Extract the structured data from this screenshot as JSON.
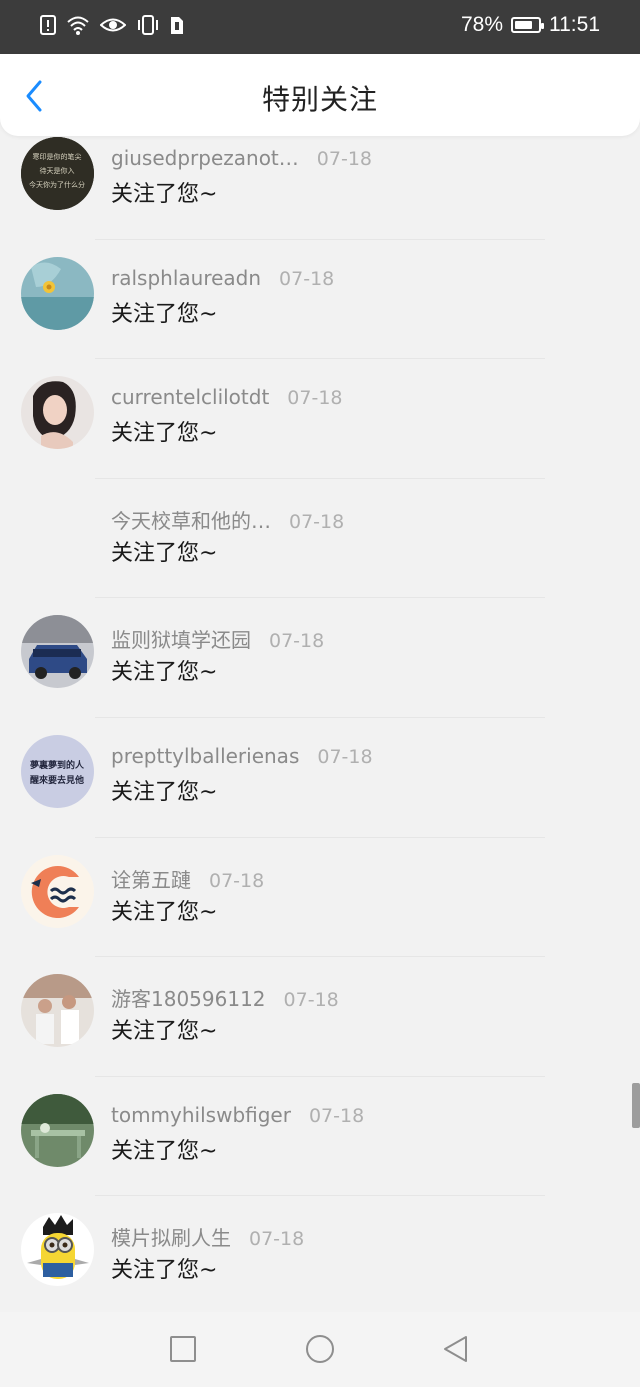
{
  "status_bar": {
    "battery": "78%",
    "time": "11:51",
    "battery_level": 0.78
  },
  "header": {
    "title": "特别关注"
  },
  "rows": [
    {
      "name": "giusedprpezanot…",
      "date": "07-18",
      "message": "关注了您~",
      "avatar_text": [
        "寒印是你的笔尖",
        "待天是你入",
        "今天你为了什么分"
      ]
    },
    {
      "name": "ralsphlaureadn",
      "date": "07-18",
      "message": "关注了您~"
    },
    {
      "name": "currentelclilotdt",
      "date": "07-18",
      "message": "关注了您~"
    },
    {
      "name": "今天校草和他的…",
      "date": "07-18",
      "message": "关注了您~"
    },
    {
      "name": "监则狱填学还园",
      "date": "07-18",
      "message": "关注了您~"
    },
    {
      "name": "prepttylballerienas",
      "date": "07-18",
      "message": "关注了您~",
      "avatar_text": [
        "夢裏夢到的人",
        "醒來要去見他"
      ]
    },
    {
      "name": "诠第五蹥",
      "date": "07-18",
      "message": "关注了您~"
    },
    {
      "name": "游客180596112",
      "date": "07-18",
      "message": "关注了您~"
    },
    {
      "name": "tommyhilswbfiger",
      "date": "07-18",
      "message": "关注了您~"
    },
    {
      "name": "模片拟刷人生",
      "date": "07-18",
      "message": "关注了您~"
    }
  ],
  "icons": {
    "status_left": [
      "alert-icon",
      "wifi-icon",
      "eye-icon",
      "vibrate-icon",
      "sim-icon"
    ],
    "nav": [
      "recents-square-icon",
      "home-circle-icon",
      "back-triangle-icon"
    ]
  },
  "colors": {
    "accent": "#1a8cff",
    "status_bar": "#3c3c3c"
  }
}
